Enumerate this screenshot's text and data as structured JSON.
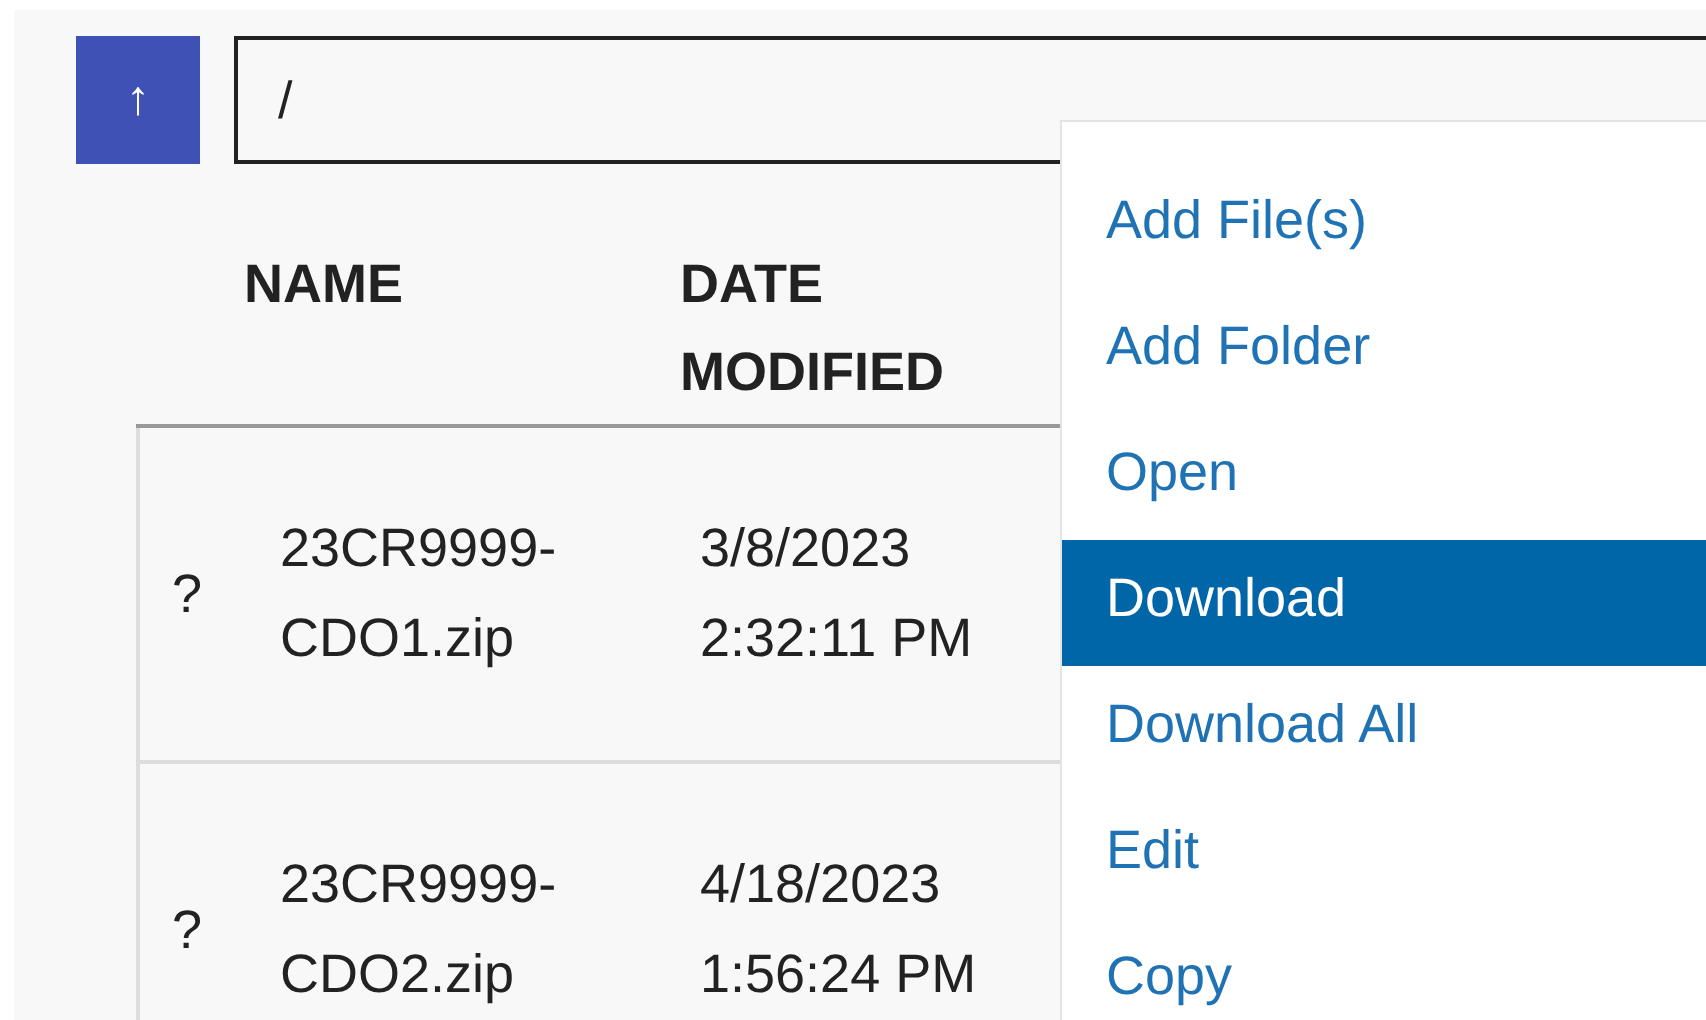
{
  "toolbar": {
    "up_button": "↑",
    "path": "/"
  },
  "table": {
    "columns": [
      {
        "label": "NAME"
      },
      {
        "label": "DATE MODIFIED"
      }
    ],
    "rows": [
      {
        "icon": "?",
        "name": "23CR9999-CDO1.zip",
        "date_modified": "3/8/2023 2:32:11 PM"
      },
      {
        "icon": "?",
        "name": "23CR9999-CDO2.zip",
        "date_modified": "4/18/2023 1:56:24 PM"
      }
    ]
  },
  "context_menu": {
    "items": [
      {
        "label": "Add File(s)",
        "selected": false
      },
      {
        "label": "Add Folder",
        "selected": false
      },
      {
        "label": "Open",
        "selected": false
      },
      {
        "label": "Download",
        "selected": true
      },
      {
        "label": "Download All",
        "selected": false
      },
      {
        "label": "Edit",
        "selected": false
      },
      {
        "label": "Copy",
        "selected": false
      }
    ]
  }
}
